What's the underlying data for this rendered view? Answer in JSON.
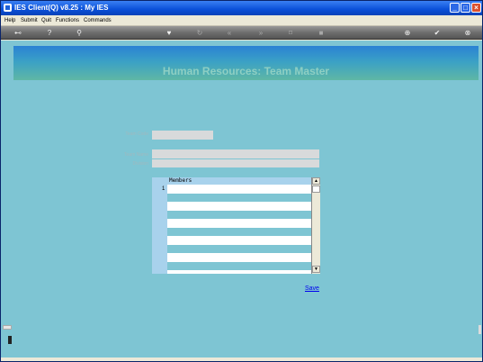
{
  "window": {
    "title": "IES Client(Q) v8.25 : My IES"
  },
  "menu": [
    "Help",
    "Submit",
    "Quit",
    "Functions",
    "Commands"
  ],
  "toolbar": [
    "key-icon",
    "help-icon",
    "search-icon",
    "heart-icon",
    "refresh-icon",
    "rewind-icon",
    "fast-forward-icon",
    "bookmark-icon",
    "stop-icon",
    "add-icon",
    "check-icon",
    "close-icon"
  ],
  "header": {
    "title": "Human Resources: Team Master"
  },
  "form": {
    "team_code_label": "Team Code",
    "team_code_value": "",
    "team_name_label": "Team Name",
    "team_name_value": "",
    "division_label": "Division",
    "division_value": ""
  },
  "members_grid": {
    "column_header": "Members",
    "first_row_number": "1",
    "rows": [
      "",
      "",
      "",
      "",
      "",
      "",
      "",
      "",
      "",
      ""
    ]
  },
  "actions": {
    "save_label": "Save"
  },
  "colors": {
    "background": "#7ec5d3",
    "header_top": "#2a82d4",
    "link": "#0000ee"
  }
}
